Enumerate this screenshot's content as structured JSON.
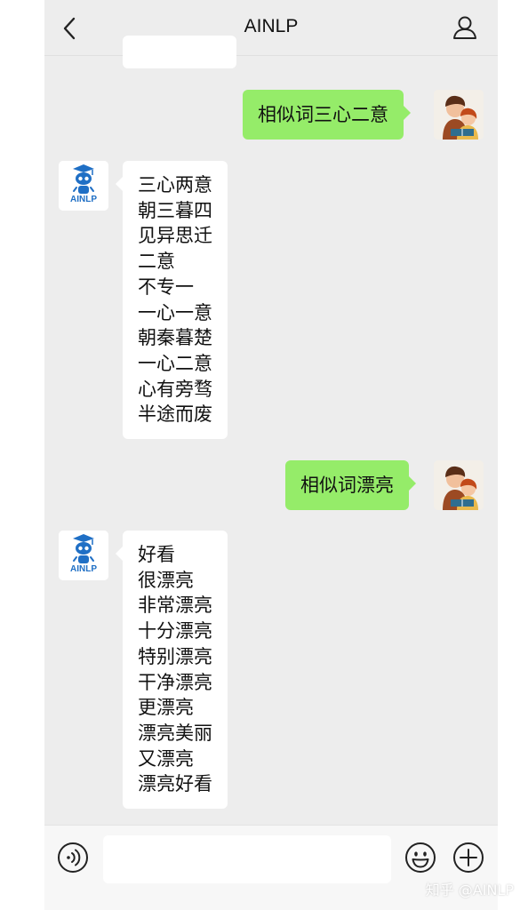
{
  "header": {
    "title": "AINLP"
  },
  "bot": {
    "avatar_label": "AINLP"
  },
  "messages": [
    {
      "from": "user",
      "text": "相似词三心二意"
    },
    {
      "from": "bot",
      "lines": [
        "三心两意",
        "朝三暮四",
        "见异思迁",
        "二意",
        "不专一",
        "一心一意",
        "朝秦暮楚",
        "一心二意",
        "心有旁骛",
        "半途而废"
      ]
    },
    {
      "from": "user",
      "text": "相似词漂亮"
    },
    {
      "from": "bot",
      "lines": [
        "好看",
        "很漂亮",
        "非常漂亮",
        "十分漂亮",
        "特别漂亮",
        "干净漂亮",
        "更漂亮",
        "漂亮美丽",
        "又漂亮",
        "漂亮好看"
      ]
    }
  ],
  "input": {
    "value": "",
    "placeholder": ""
  },
  "watermark": "知乎 @AINLP",
  "icons": [
    "back-icon",
    "profile-icon",
    "voice-icon",
    "emoji-icon",
    "plus-icon"
  ],
  "colors": {
    "user_bubble": "#95ec69",
    "bot_bubble": "#ffffff",
    "background": "#ededed"
  }
}
